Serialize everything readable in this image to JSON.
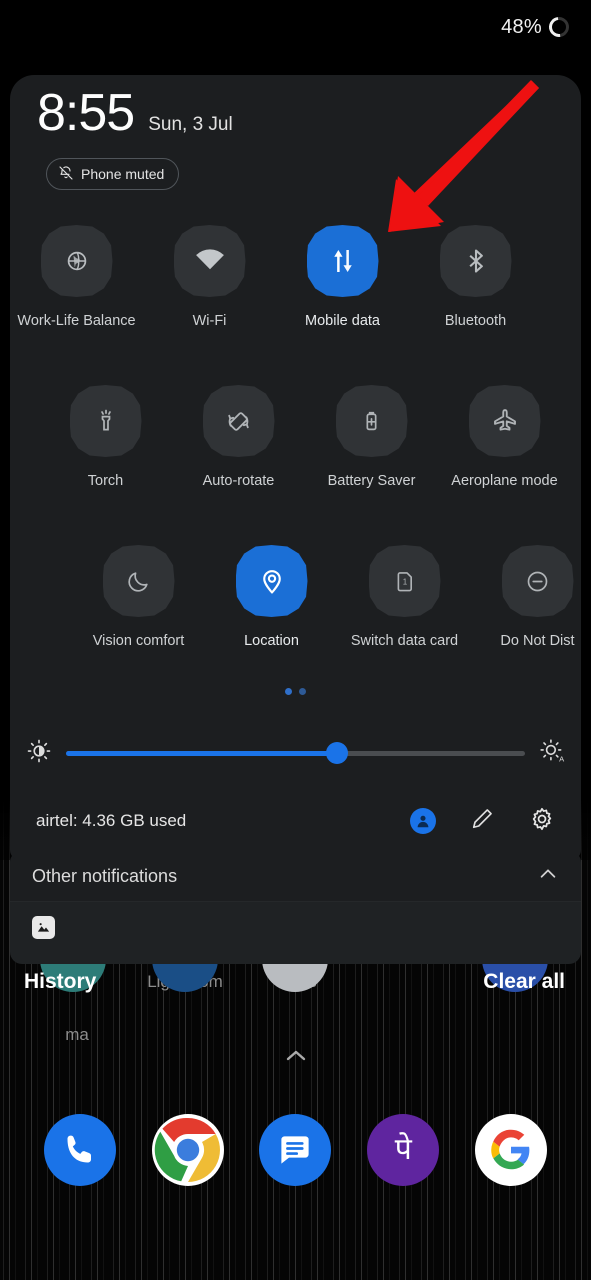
{
  "status_bar": {
    "battery_percent": "48%",
    "battery_icon": "battery-ring-icon"
  },
  "quick_settings": {
    "time": "8:55",
    "date": "Sun, 3 Jul",
    "muted_chip": {
      "label": "Phone muted",
      "icon": "bell-muted-icon"
    },
    "accent_color": "#1b6fd6",
    "tile_off_color": "#303336",
    "tiles": [
      {
        "label": "Work-Life Balance",
        "icon": "work-life-balance-icon",
        "active": false
      },
      {
        "label": "Wi-Fi",
        "icon": "wifi-icon",
        "active": false
      },
      {
        "label": "Mobile data",
        "icon": "mobile-data-icon",
        "active": true
      },
      {
        "label": "Bluetooth",
        "icon": "bluetooth-icon",
        "active": false
      },
      {
        "label": "Torch",
        "icon": "torch-icon",
        "active": false
      },
      {
        "label": "Auto-rotate",
        "icon": "auto-rotate-icon",
        "active": false
      },
      {
        "label": "Battery Saver",
        "icon": "battery-saver-icon",
        "active": false
      },
      {
        "label": "Aeroplane mode",
        "icon": "aeroplane-icon",
        "active": false
      },
      {
        "label": "Vision comfort",
        "icon": "moon-icon",
        "active": false
      },
      {
        "label": "Location",
        "icon": "location-pin-icon",
        "active": true
      },
      {
        "label": "Switch data card",
        "icon": "sim-card-icon",
        "active": false
      },
      {
        "label": "Do Not Dist",
        "icon": "do-not-disturb-icon",
        "active": false
      }
    ],
    "pages": {
      "count": 2,
      "current": 1
    },
    "brightness": {
      "value_percent": 59,
      "low_icon": "brightness-low-icon",
      "auto_icon": "brightness-auto-icon"
    },
    "footer": {
      "carrier_text": "airtel: 4.36 GB used",
      "actions": [
        {
          "name": "user-account-icon"
        },
        {
          "name": "edit-pencil-icon"
        },
        {
          "name": "settings-gear-icon"
        }
      ]
    }
  },
  "notifications": {
    "section_title": "Other notifications",
    "collapse_icon": "chevron-up-icon",
    "items": [
      {
        "icon": "image-icon"
      }
    ],
    "history_label": "History",
    "clear_all_label": "Clear all"
  },
  "home_screen": {
    "app_labels": [
      {
        "label": "ma",
        "color": "#2d7c78"
      },
      {
        "label": "Lightroom",
        "color": "#1a4e86"
      },
      {
        "label": "Tasks",
        "color": "#b9bcc0"
      },
      {
        "label": "",
        "color": "#2a4fa8"
      }
    ],
    "second_row_label": "ma",
    "drawer_handle_icon": "chevron-up-icon",
    "dock": [
      {
        "name": "phone-icon",
        "label": "Phone",
        "color": "#1a73e8"
      },
      {
        "name": "chrome-icon",
        "label": "Chrome",
        "color": "#ffffff"
      },
      {
        "name": "messages-icon",
        "label": "Messages",
        "color": "#1a73e8"
      },
      {
        "name": "phonepe-icon",
        "label": "PhonePe",
        "color": "#5f259f",
        "glyph": "पे"
      },
      {
        "name": "google-icon",
        "label": "Google",
        "color": "#ffffff"
      }
    ]
  },
  "annotation": {
    "arrow_color": "#ee1111",
    "points_to": "Mobile data"
  }
}
